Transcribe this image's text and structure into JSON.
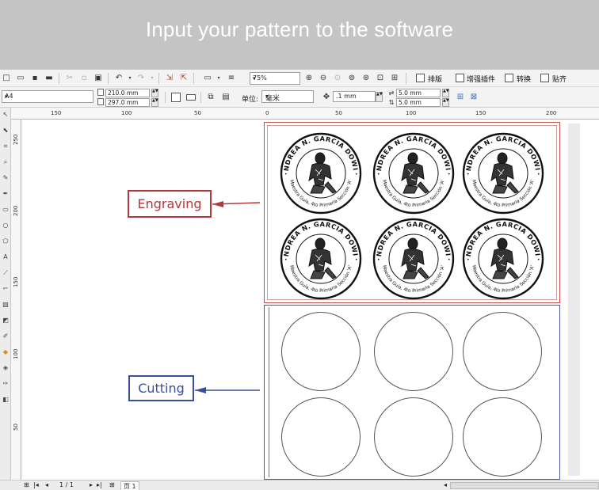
{
  "banner": {
    "title": "Input your pattern to the software"
  },
  "toolbar": {
    "zoom": "75%",
    "commands": [
      {
        "label": "排版",
        "icon": "layout-icon"
      },
      {
        "label": "增强插件",
        "icon": "plugin-icon"
      },
      {
        "label": "转换",
        "icon": "convert-icon"
      },
      {
        "label": "贴齐",
        "icon": "snap-icon"
      }
    ]
  },
  "property_bar": {
    "page_size": "A4",
    "width": "210.0 mm",
    "height": "297.0 mm",
    "unit_label": "单位:",
    "unit_value": "毫米",
    "nudge": ".1 mm",
    "dup_x": "5.0 mm",
    "dup_y": "5.0 mm"
  },
  "ruler": {
    "top_ticks": [
      "150",
      "100",
      "50",
      "0",
      "50",
      "100",
      "150",
      "200"
    ],
    "left_ticks": [
      "250",
      "200",
      "150",
      "100",
      "50"
    ]
  },
  "stamp": {
    "top_text": "ANDREA N. GARCIA DOWIN",
    "bottom_text": "Maestra Guía, 4to Primaria Sección 'A'",
    "count": 6
  },
  "cut_circles": {
    "count": 6
  },
  "callouts": {
    "engraving": "Engraving",
    "cutting": "Cutting",
    "engraving_color": "#b0393b",
    "cutting_color": "#3a4f9c"
  },
  "status": {
    "page_counter": "1 / 1",
    "page_tab": "页 1"
  }
}
